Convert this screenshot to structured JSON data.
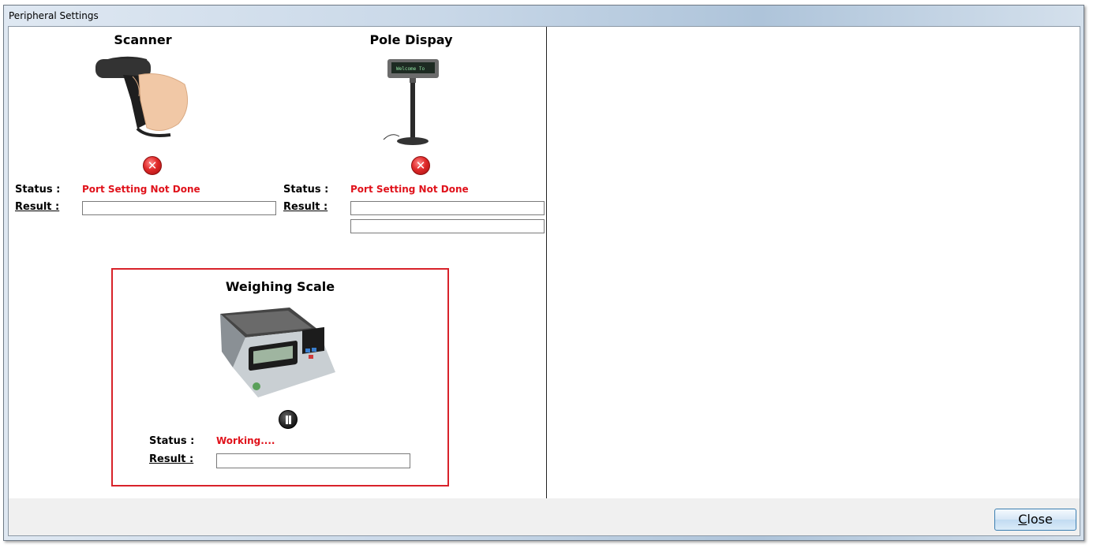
{
  "window": {
    "title": "Peripheral Settings"
  },
  "scanner": {
    "title": "Scanner",
    "status_label": "Status :",
    "status_value": "Port Setting Not Done",
    "result_label": "Result :",
    "state_icon": "error-icon"
  },
  "pole_display": {
    "title": "Pole Dispay",
    "status_label": "Status :",
    "status_value": "Port Setting Not Done",
    "result_label": "Result :",
    "state_icon": "error-icon",
    "display_text": "Welcome To"
  },
  "weighing_scale": {
    "title": "Weighing Scale",
    "status_label": "Status :",
    "status_value": "Working....",
    "result_label": "Result :",
    "state_icon": "pause-icon"
  },
  "footer": {
    "close_first": "C",
    "close_rest": "lose"
  },
  "colors": {
    "status_error": "#e0121b",
    "highlight_border": "#d8222a"
  }
}
